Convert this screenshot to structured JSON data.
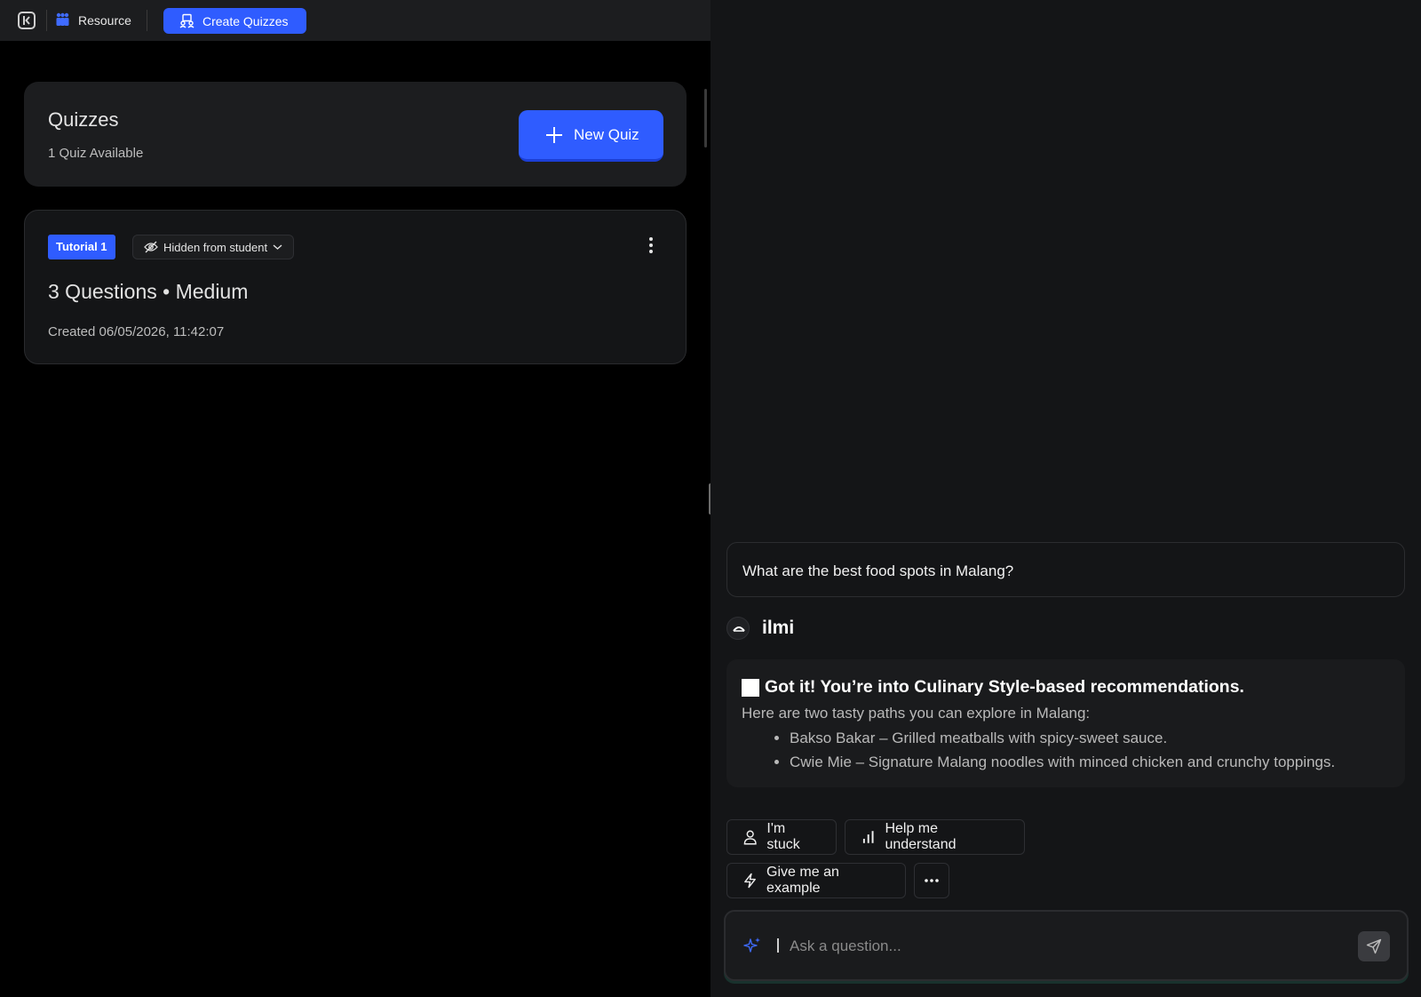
{
  "topbar": {
    "resource_label": "Resource",
    "create_quizzes_label": "Create Quizzes",
    "accent": "#2f5cff"
  },
  "quizzes": {
    "title": "Quizzes",
    "count_text": "1 Quiz Available",
    "new_quiz_label": "New Quiz"
  },
  "quiz_card": {
    "tag": "Tutorial 1",
    "visibility": "Hidden from student",
    "summary": "3 Questions • Medium",
    "created": "Created 06/05/2026, 11:42:07"
  },
  "chat": {
    "user_message": "What are the best food spots in Malang?",
    "bot_name": "ilmi",
    "bot_heading": "Got it! You’re into Culinary Style-based recommendations.",
    "bot_intro": "Here are two tasty paths you can explore in Malang:",
    "bot_items": [
      "Bakso Bakar – Grilled meatballs with spicy-sweet sauce.",
      "Cwie Mie – Signature Malang noodles with minced chicken and crunchy toppings."
    ],
    "chips": {
      "stuck": "I'm stuck",
      "help": "Help me understand",
      "example": "Give me an example"
    },
    "input_placeholder": "Ask a question..."
  },
  "icons": [
    "sidebar-collapse-icon",
    "resource-icon",
    "quiz-icon",
    "plus-icon",
    "eye-off-icon",
    "chevron-down-icon",
    "more-vertical-icon",
    "user-icon",
    "bar-chart-icon",
    "lightning-icon",
    "more-horizontal-icon",
    "sparkle-icon",
    "send-icon"
  ]
}
